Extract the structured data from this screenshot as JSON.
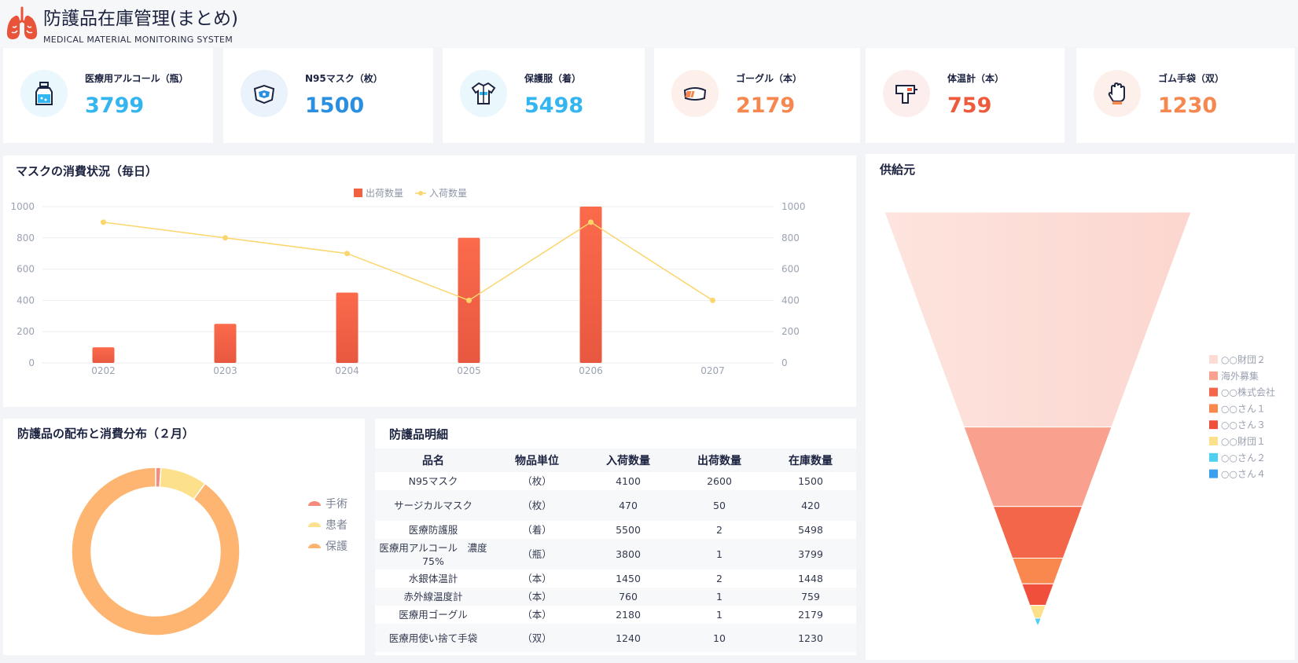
{
  "header": {
    "title": "防護品在庫管理(まとめ)",
    "subtitle": "MEDICAL MATERIAL MONITORING SYSTEM"
  },
  "stats": [
    {
      "label": "医療用アルコール（瓶）",
      "value": "3799",
      "color": "#33b5f0",
      "bg": "#eaf7fd",
      "icon": "alcohol-bottle-icon"
    },
    {
      "label": "N95マスク（枚）",
      "value": "1500",
      "color": "#2a8fe0",
      "bg": "#eaf3fc",
      "icon": "mask-icon"
    },
    {
      "label": "保護服（着）",
      "value": "5498",
      "color": "#33b5f0",
      "bg": "#eaf7fd",
      "icon": "protective-suit-icon"
    },
    {
      "label": "ゴーグル（本）",
      "value": "2179",
      "color": "#f5874f",
      "bg": "#fdf0ea",
      "icon": "goggles-icon"
    },
    {
      "label": "体温計（本）",
      "value": "759",
      "color": "#ee5a3c",
      "bg": "#fdeeee",
      "icon": "thermometer-icon"
    },
    {
      "label": "ゴム手袋（双）",
      "value": "1230",
      "color": "#f5874f",
      "bg": "#fdf0ea",
      "icon": "glove-icon"
    }
  ],
  "mask_panel": {
    "title": "マスクの消費状況（毎日）"
  },
  "supplier_panel": {
    "title": "供給元"
  },
  "donut_panel": {
    "title": "防護品の配布と消費分布（２月）"
  },
  "table_panel": {
    "title": "防護品明細",
    "columns": [
      "品名",
      "物品単位",
      "入荷数量",
      "出荷数量",
      "在庫数量"
    ],
    "rows": [
      [
        "N95マスク",
        "（枚）",
        "4100",
        "2600",
        "1500"
      ],
      [
        "サージカルマスク",
        "（枚）",
        "470",
        "50",
        "420"
      ],
      [
        "医療防護服",
        "（着）",
        "5500",
        "2",
        "5498"
      ],
      [
        "医療用アルコール　濃度75%",
        "（瓶）",
        "3800",
        "1",
        "3799"
      ],
      [
        "水銀体温計",
        "（本）",
        "1450",
        "2",
        "1448"
      ],
      [
        "赤外線温度計",
        "（本）",
        "760",
        "1",
        "759"
      ],
      [
        "医療用ゴーグル",
        "（本）",
        "2180",
        "1",
        "2179"
      ],
      [
        "医療用使い捨て手袋",
        "（双）",
        "1240",
        "10",
        "1230"
      ]
    ]
  },
  "chart_data": [
    {
      "type": "bar",
      "categories": [
        "0202",
        "0203",
        "0204",
        "0205",
        "0206",
        "0207"
      ],
      "series": [
        {
          "name": "出荷数量",
          "type": "bar",
          "values": [
            100,
            250,
            450,
            800,
            1000,
            0
          ],
          "color": "#f2603f"
        },
        {
          "name": "入荷数量",
          "type": "line",
          "values": [
            900,
            800,
            700,
            400,
            900,
            400
          ],
          "color": "#fbd66d"
        }
      ],
      "yticks": [
        0,
        200,
        400,
        600,
        800,
        1000
      ],
      "ylim": [
        0,
        1000
      ],
      "y2ticks": [
        0,
        200,
        400,
        600,
        800,
        1000
      ],
      "legend_position": "top-center",
      "grid": true
    },
    {
      "type": "pie",
      "subtype": "donut",
      "labels": [
        "手術",
        "患者",
        "保護"
      ],
      "values": [
        1,
        9,
        90
      ],
      "colors": [
        "#f78b7b",
        "#fde08c",
        "#fdb571"
      ],
      "legend_position": "right"
    },
    {
      "type": "funnel",
      "labels": [
        "○○財団２",
        "海外募集",
        "○○株式会社",
        "○○さん１",
        "○○さん３",
        "○○財団１",
        "○○さん２",
        "○○さん４"
      ],
      "values": [
        100,
        37,
        24,
        12,
        10,
        6,
        3,
        1
      ],
      "colors": [
        "#fddcd6",
        "#f9a08e",
        "#f4664a",
        "#f8884e",
        "#f04f3c",
        "#fde08c",
        "#4fd0f2",
        "#3b9ff0"
      ],
      "legend_position": "right"
    }
  ]
}
